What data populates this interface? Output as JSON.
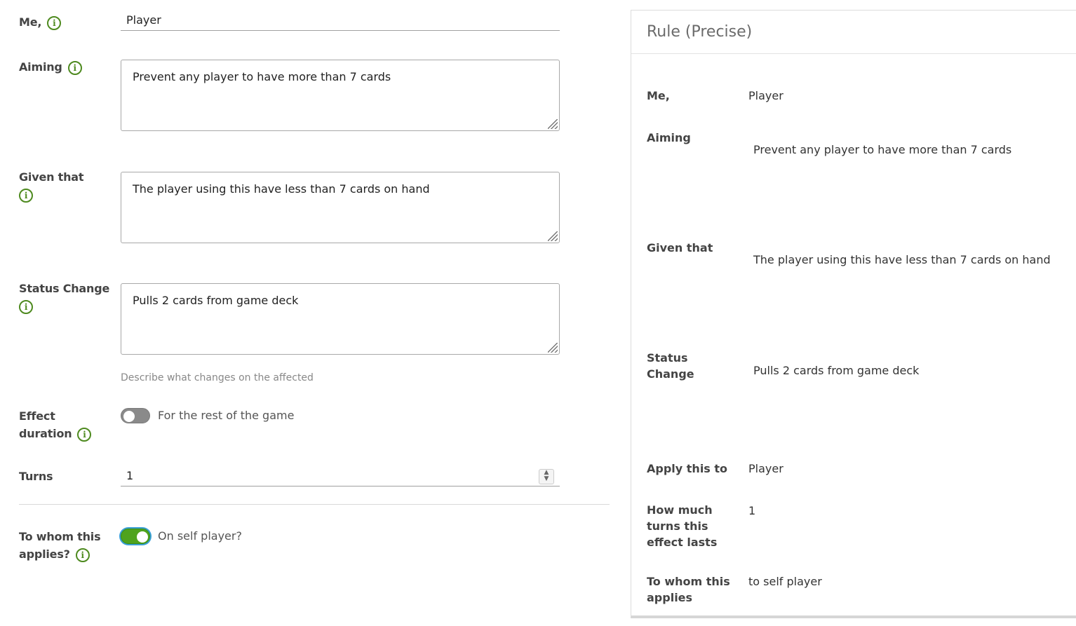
{
  "form": {
    "me": {
      "label": "Me,",
      "value": "Player"
    },
    "aiming": {
      "label": "Aiming",
      "value": "Prevent any player to have more than 7 cards"
    },
    "given_that": {
      "label": "Given that",
      "value": "The player using this have less than 7 cards on hand"
    },
    "status_change": {
      "label": "Status Change",
      "value": "Pulls 2 cards from game deck",
      "helper": "Describe what changes on the affected"
    },
    "effect_duration": {
      "label_line1": "Effect",
      "label_line2": "duration",
      "toggle_label": "For the rest of the game",
      "toggle_on": false
    },
    "turns": {
      "label": "Turns",
      "value": "1"
    },
    "to_whom": {
      "label_line1": "To whom this",
      "label_line2": "applies?",
      "toggle_label": "On self player?",
      "toggle_on": true
    }
  },
  "panel": {
    "title": "Rule (Precise)",
    "rows": {
      "me": {
        "key": "Me,",
        "value": "Player"
      },
      "aiming": {
        "key": "Aiming",
        "value": "Prevent any player to have more than 7 cards"
      },
      "given_that": {
        "key": "Given that",
        "value": "The player using this have less than 7 cards on hand"
      },
      "status_change": {
        "key_line1": "Status",
        "key_line2": "Change",
        "value": "Pulls 2 cards from game deck"
      },
      "apply_to": {
        "key": "Apply this to",
        "value": "Player"
      },
      "turns": {
        "key_line1": "How much",
        "key_line2": "turns this",
        "key_line3": "effect lasts",
        "value": "1"
      },
      "to_whom": {
        "key_line1": "To whom this",
        "key_line2": "applies",
        "value": "to self player"
      }
    }
  },
  "colors": {
    "accent_green": "#4fa31e",
    "info_green": "#4e8a1f",
    "focus_blue": "#3aa0d6"
  }
}
